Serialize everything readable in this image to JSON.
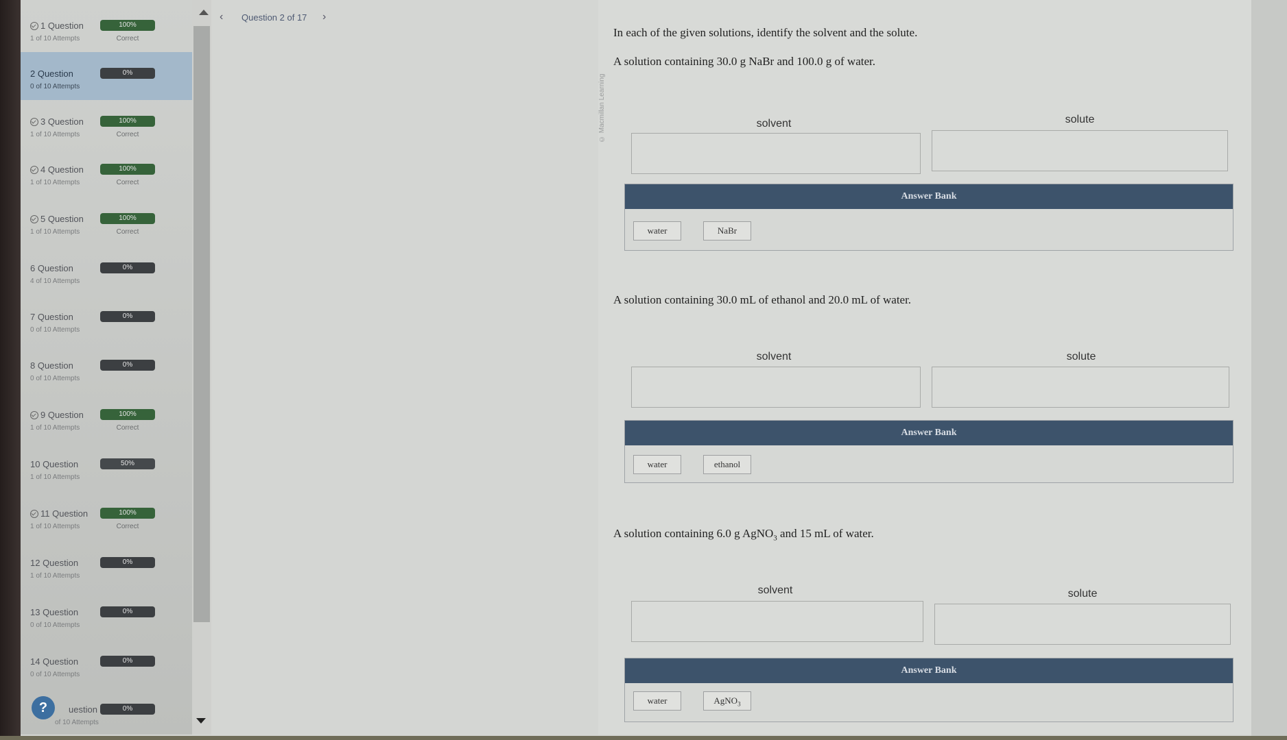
{
  "sidebar": {
    "questions": [
      {
        "title": "1 Question",
        "attempts": "1 of 10 Attempts",
        "score": "100%",
        "status": "Correct"
      },
      {
        "title": "2 Question",
        "attempts": "0 of 10 Attempts",
        "score": "0%",
        "status": ""
      },
      {
        "title": "3 Question",
        "attempts": "1 of 10 Attempts",
        "score": "100%",
        "status": "Correct"
      },
      {
        "title": "4 Question",
        "attempts": "1 of 10 Attempts",
        "score": "100%",
        "status": "Correct"
      },
      {
        "title": "5 Question",
        "attempts": "1 of 10 Attempts",
        "score": "100%",
        "status": "Correct"
      },
      {
        "title": "6 Question",
        "attempts": "4 of 10 Attempts",
        "score": "0%",
        "status": ""
      },
      {
        "title": "7 Question",
        "attempts": "0 of 10 Attempts",
        "score": "0%",
        "status": ""
      },
      {
        "title": "8 Question",
        "attempts": "0 of 10 Attempts",
        "score": "0%",
        "status": ""
      },
      {
        "title": "9 Question",
        "attempts": "1 of 10 Attempts",
        "score": "100%",
        "status": "Correct"
      },
      {
        "title": "10 Question",
        "attempts": "1 of 10 Attempts",
        "score": "50%",
        "status": ""
      },
      {
        "title": "11 Question",
        "attempts": "1 of 10 Attempts",
        "score": "100%",
        "status": "Correct"
      },
      {
        "title": "12 Question",
        "attempts": "1 of 10 Attempts",
        "score": "0%",
        "status": ""
      },
      {
        "title": "13 Question",
        "attempts": "0 of 10 Attempts",
        "score": "0%",
        "status": ""
      },
      {
        "title": "14 Question",
        "attempts": "0 of 10 Attempts",
        "score": "0%",
        "status": ""
      },
      {
        "title": "uestion",
        "attempts": "of 10 Attempts",
        "score": "0%",
        "status": ""
      }
    ],
    "help_label": "?"
  },
  "nav": {
    "prev": "‹",
    "title": "Question 2 of 17",
    "next": "›"
  },
  "credit": "© Macmillan Learning",
  "instructions": "In each of the given solutions, identify the solvent and the solute.",
  "parts": [
    {
      "prompt": "A solution containing 30.0 g NaBr and 100.0 g of water.",
      "solvent_label": "solvent",
      "solute_label": "solute",
      "bank_title": "Answer Bank",
      "choices": [
        "water",
        "NaBr"
      ]
    },
    {
      "prompt": "A solution containing 30.0 mL of ethanol and 20.0 mL of water.",
      "solvent_label": "solvent",
      "solute_label": "solute",
      "bank_title": "Answer Bank",
      "choices": [
        "water",
        "ethanol"
      ]
    },
    {
      "prompt_pre": "A solution containing 6.0 g AgNO",
      "prompt_sub": "3",
      "prompt_post": " and 15 mL of water.",
      "solvent_label": "solvent",
      "solute_label": "solute",
      "bank_title": "Answer Bank",
      "choice_water": "water",
      "choice_salt_pre": "AgNO",
      "choice_salt_sub": "3"
    }
  ]
}
